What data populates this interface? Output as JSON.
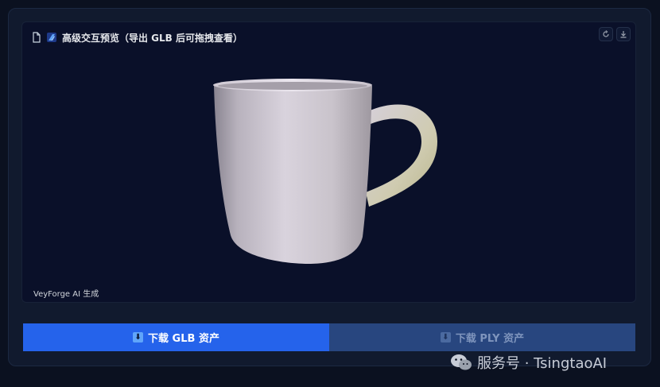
{
  "viewer": {
    "title": "高级交互预览（导出 GLB 后可拖拽查看）",
    "generated_by": "VeyForge AI 生成",
    "icons": {
      "file": "file-icon",
      "title_emoji": "crystal-icon",
      "reset": "reset-icon",
      "download": "download-icon"
    }
  },
  "actions": {
    "glb_label": "下载 GLB 资产",
    "ply_label": "下载 PLY 资产"
  },
  "watermark": {
    "text": "服务号 · TsingtaoAI"
  },
  "colors": {
    "primary": "#2563eb",
    "secondary": "#28467f",
    "viewer_bg": "#0a1029",
    "panel_bg": "#111a2e"
  }
}
